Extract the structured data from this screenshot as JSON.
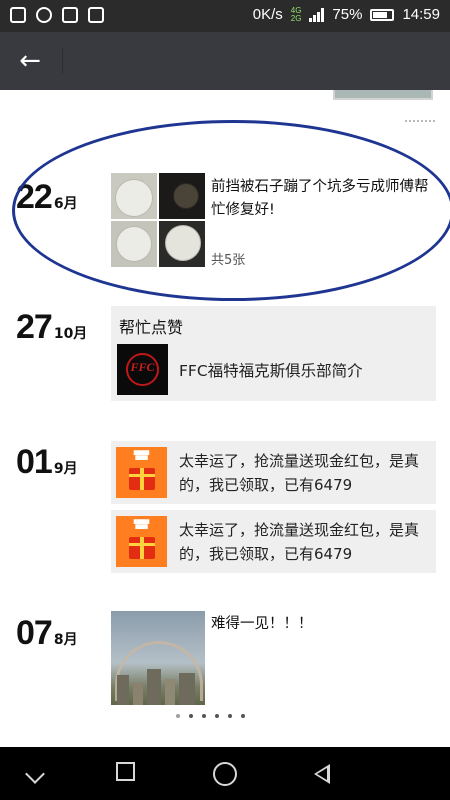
{
  "status_bar": {
    "speed": "0K/s",
    "net_top": "4G",
    "net_bottom": "2G",
    "battery": "75%",
    "battery_level": 0.75,
    "time": "14:59",
    "left_icons": [
      "notification-icon",
      "chat-icon",
      "image-icon",
      "app-icon"
    ]
  },
  "app_bar": {
    "back_icon": "←"
  },
  "posts": [
    {
      "day": "22",
      "month": "6月",
      "text": "前挡被石子蹦了个坑多亏成师傅帮忙修复好!",
      "count": "共5张"
    },
    {
      "day": "27",
      "month": "10月",
      "card_title": "帮忙点赞",
      "logo_text": "FFC",
      "link_text": "FFC福特福克斯俱乐部简介"
    },
    {
      "day": "01",
      "month": "9月",
      "items": [
        {
          "text": "太幸运了，抢流量送现金红包，是真的，我已领取，已有6479"
        },
        {
          "text": "太幸运了，抢流量送现金红包，是真的，我已领取，已有6479"
        }
      ]
    },
    {
      "day": "07",
      "month": "8月",
      "text": "难得一见！！！"
    }
  ],
  "highlight_color": "#1e3591",
  "nav_bar": {
    "icons": [
      "chevron-down-icon",
      "square-icon",
      "circle-home-icon",
      "triangle-back-icon"
    ]
  }
}
